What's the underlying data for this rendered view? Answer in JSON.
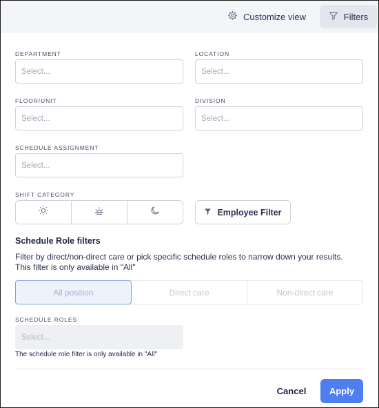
{
  "header": {
    "customize_label": "Customize view",
    "filters_label": "Filters"
  },
  "fields": {
    "department": {
      "label": "DEPARTMENT",
      "placeholder": "Select..."
    },
    "location": {
      "label": "LOCATION",
      "placeholder": "Select..."
    },
    "floor_unit": {
      "label": "FLOOR/UNIT",
      "placeholder": "Select..."
    },
    "division": {
      "label": "DIVISION",
      "placeholder": "Select..."
    },
    "schedule_assignment": {
      "label": "SCHEDULE ASSIGNMENT",
      "placeholder": "Select..."
    },
    "shift_category": {
      "label": "SHIFT CATEGORY",
      "options": [
        "day-sun-icon",
        "sunrise-icon",
        "night-moon-icon"
      ]
    }
  },
  "employee_filter_label": "Employee Filter",
  "schedule_role": {
    "title": "Schedule Role filters",
    "description": "Filter by direct/non-direct care or pick specific schedule roles to narrow down your results. This filter is only available in \"All\"",
    "positions": [
      "All position",
      "Direct care",
      "Non-direct care"
    ],
    "selected_position": "All position",
    "roles_label": "SCHEDULE ROLES",
    "roles_placeholder": "Select...",
    "roles_hint": "The schedule role filter is only available in \"All\""
  },
  "footer": {
    "cancel_label": "Cancel",
    "apply_label": "Apply"
  },
  "colors": {
    "accent": "#4f7ef0",
    "header_bg": "#f4f5f9",
    "text": "#1f2544"
  }
}
